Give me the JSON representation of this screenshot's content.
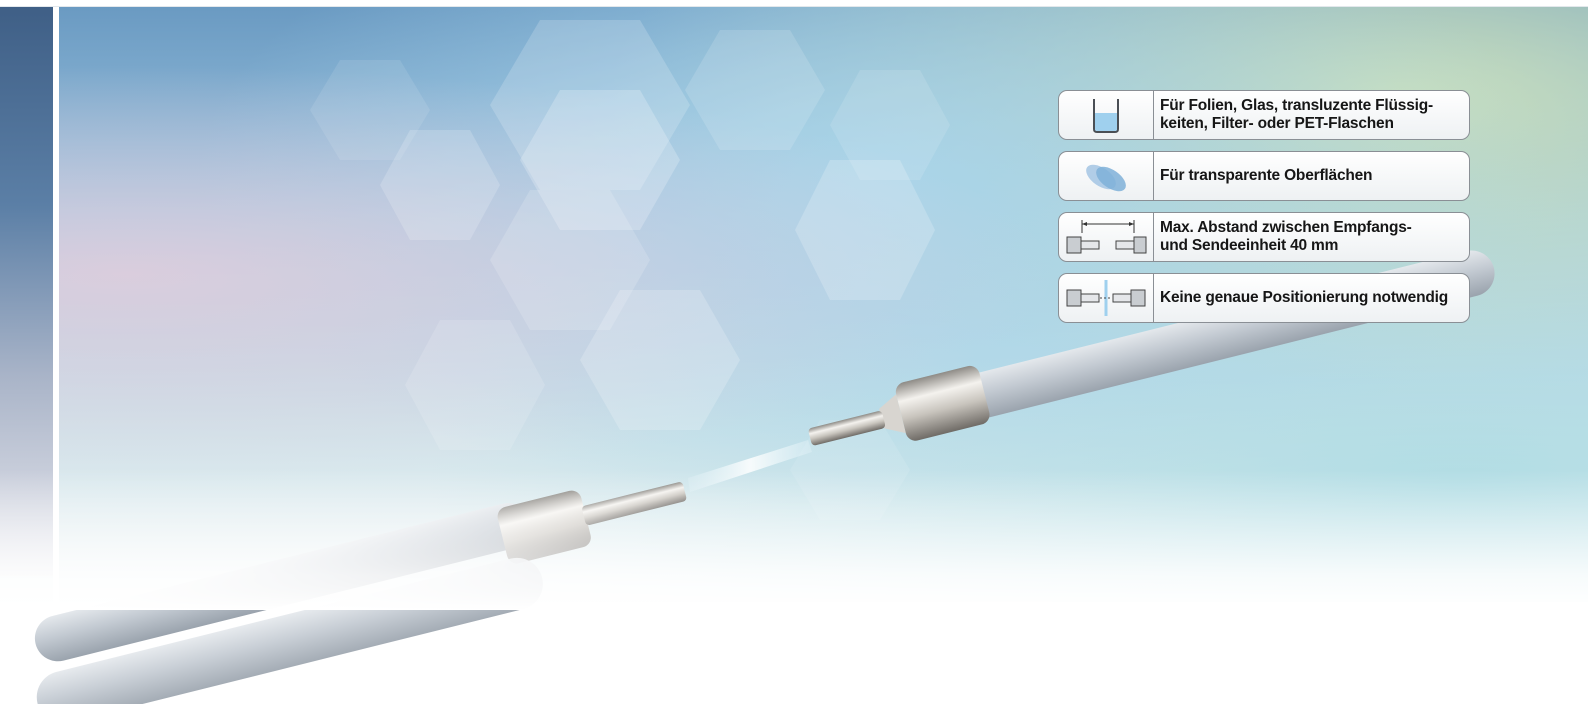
{
  "features": [
    {
      "icon": "liquid-glass-icon",
      "text": "Für Folien, Glas, transluzente Flüssig-\nkeiten, Filter- oder PET-Flaschen"
    },
    {
      "icon": "transparent-lenses-icon",
      "text": "Für transparente Oberflächen"
    },
    {
      "icon": "distance-measure-icon",
      "text": "Max. Abstand zwischen Empfangs-\nund Sendeeinheit 40 mm"
    },
    {
      "icon": "alignment-tolerance-icon",
      "text": "Keine genaue Positionierung notwendig"
    }
  ],
  "colors": {
    "panel_border": "#8a8f95",
    "panel_text": "#161616",
    "left_strip_top": "#3f5f86",
    "cable_gray": "#c6ccd3",
    "liquid_blue": "#9fd0ee"
  }
}
